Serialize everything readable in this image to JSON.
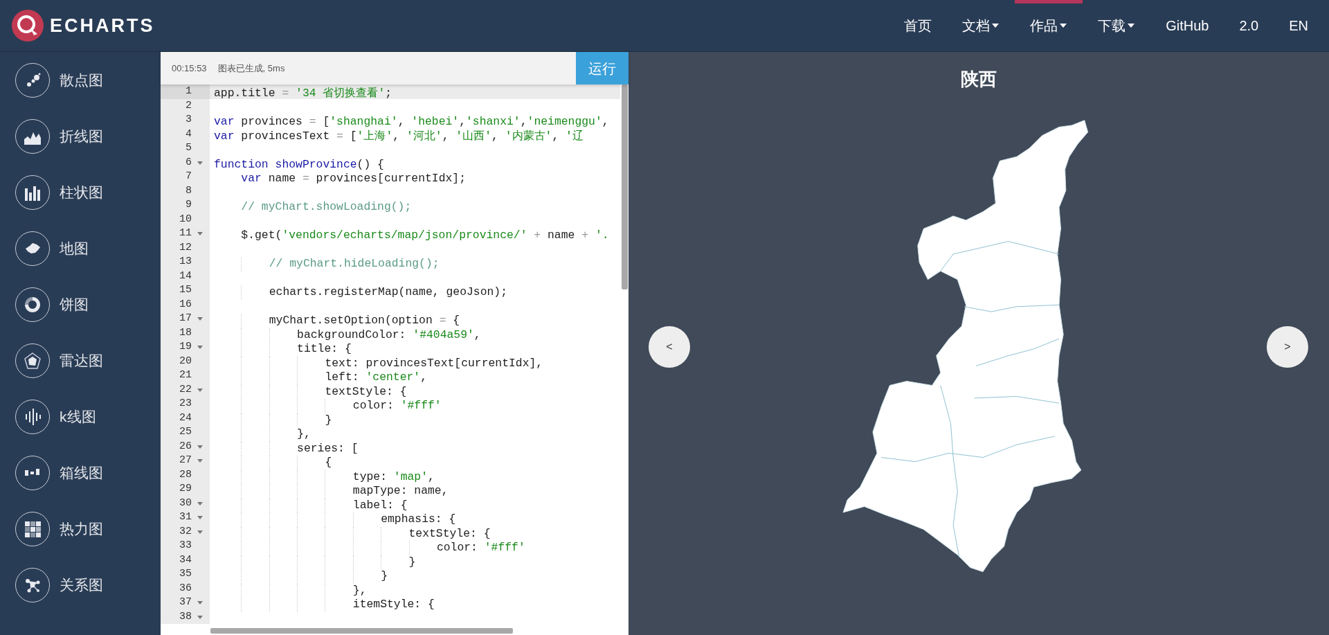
{
  "header": {
    "logo_text": "ECHARTS",
    "nav": [
      {
        "label": "首页",
        "dropdown": false,
        "selected": false
      },
      {
        "label": "文档",
        "dropdown": true,
        "selected": false
      },
      {
        "label": "作品",
        "dropdown": true,
        "selected": true
      },
      {
        "label": "下载",
        "dropdown": true,
        "selected": false
      },
      {
        "label": "GitHub",
        "dropdown": false,
        "selected": false
      },
      {
        "label": "2.0",
        "dropdown": false,
        "selected": false
      },
      {
        "label": "EN",
        "dropdown": false,
        "selected": false
      }
    ]
  },
  "sidebar": {
    "items": [
      {
        "label": "散点图",
        "kind": "scatter"
      },
      {
        "label": "折线图",
        "kind": "line"
      },
      {
        "label": "柱状图",
        "kind": "bar"
      },
      {
        "label": "地图",
        "kind": "map"
      },
      {
        "label": "饼图",
        "kind": "pie"
      },
      {
        "label": "雷达图",
        "kind": "radar"
      },
      {
        "label": "k线图",
        "kind": "candlestick"
      },
      {
        "label": "箱线图",
        "kind": "boxplot"
      },
      {
        "label": "热力图",
        "kind": "heatmap"
      },
      {
        "label": "关系图",
        "kind": "graph"
      }
    ]
  },
  "editor": {
    "time": "00:15:53",
    "status": "图表已生成, 5ms",
    "run_button": "运行",
    "lines": [
      {
        "n": "1",
        "active": true,
        "fold": false,
        "tokens": [
          {
            "kind": "plain",
            "t": "app.title "
          },
          {
            "kind": "op",
            "t": "= "
          },
          {
            "kind": "str",
            "t": "'34 省切换查看'"
          },
          {
            "kind": "plain",
            "t": ";"
          }
        ]
      },
      {
        "n": "2",
        "active": false,
        "fold": false
      },
      {
        "n": "3",
        "active": false,
        "fold": false,
        "tokens": [
          {
            "kind": "kw",
            "t": "var"
          },
          {
            "kind": "plain",
            "t": " provinces "
          },
          {
            "kind": "op",
            "t": "= "
          },
          {
            "kind": "plain",
            "t": "["
          },
          {
            "kind": "str",
            "t": "'shanghai'"
          },
          {
            "kind": "plain",
            "t": ", "
          },
          {
            "kind": "str",
            "t": "'hebei'"
          },
          {
            "kind": "plain",
            "t": ","
          },
          {
            "kind": "str",
            "t": "'shanxi'"
          },
          {
            "kind": "plain",
            "t": ","
          },
          {
            "kind": "str",
            "t": "'neimenggu'"
          },
          {
            "kind": "plain",
            "t": ","
          }
        ]
      },
      {
        "n": "4",
        "active": false,
        "fold": false,
        "tokens": [
          {
            "kind": "kw",
            "t": "var"
          },
          {
            "kind": "plain",
            "t": " provincesText "
          },
          {
            "kind": "op",
            "t": "= "
          },
          {
            "kind": "plain",
            "t": "["
          },
          {
            "kind": "str",
            "t": "'上海'"
          },
          {
            "kind": "plain",
            "t": ", "
          },
          {
            "kind": "str",
            "t": "'河北'"
          },
          {
            "kind": "plain",
            "t": ", "
          },
          {
            "kind": "str",
            "t": "'山西'"
          },
          {
            "kind": "plain",
            "t": ", "
          },
          {
            "kind": "str",
            "t": "'内蒙古'"
          },
          {
            "kind": "plain",
            "t": ", "
          },
          {
            "kind": "str",
            "t": "'辽"
          }
        ]
      },
      {
        "n": "5",
        "active": false,
        "fold": false
      },
      {
        "n": "6",
        "active": false,
        "fold": true,
        "tokens": [
          {
            "kind": "kw",
            "t": "function"
          },
          {
            "kind": "kw",
            "t": " showProvince"
          },
          {
            "kind": "plain",
            "t": "() {"
          }
        ]
      },
      {
        "n": "7",
        "active": false,
        "fold": false,
        "tokens": [
          {
            "kind": "kw",
            "t": "    var"
          },
          {
            "kind": "plain",
            "t": " name "
          },
          {
            "kind": "op",
            "t": "= "
          },
          {
            "kind": "plain",
            "t": "provinces[currentIdx];"
          }
        ]
      },
      {
        "n": "8",
        "active": false,
        "fold": false
      },
      {
        "n": "9",
        "active": false,
        "fold": false,
        "tokens": [
          {
            "kind": "com",
            "t": "    // myChart.showLoading();"
          }
        ]
      },
      {
        "n": "10",
        "active": false,
        "fold": false
      },
      {
        "n": "11",
        "active": false,
        "fold": true,
        "tokens": [
          {
            "kind": "plain",
            "t": "    $.get("
          },
          {
            "kind": "str",
            "t": "'vendors/echarts/map/json/province/'"
          },
          {
            "kind": "op",
            "t": " + "
          },
          {
            "kind": "plain",
            "t": "name "
          },
          {
            "kind": "op",
            "t": "+ "
          },
          {
            "kind": "str",
            "t": "'."
          }
        ]
      },
      {
        "n": "12",
        "active": false,
        "fold": false
      },
      {
        "n": "13",
        "active": false,
        "fold": false,
        "tokens": [
          {
            "kind": "com",
            "t": "        // myChart.hideLoading();"
          }
        ]
      },
      {
        "n": "14",
        "active": false,
        "fold": false
      },
      {
        "n": "15",
        "active": false,
        "fold": false,
        "tokens": [
          {
            "kind": "plain",
            "t": "        echarts.registerMap(name, geoJson);"
          }
        ]
      },
      {
        "n": "16",
        "active": false,
        "fold": false
      },
      {
        "n": "17",
        "active": false,
        "fold": true,
        "tokens": [
          {
            "kind": "plain",
            "t": "        myChart.setOption(option "
          },
          {
            "kind": "op",
            "t": "= "
          },
          {
            "kind": "plain",
            "t": "{"
          }
        ]
      },
      {
        "n": "18",
        "active": false,
        "fold": false,
        "tokens": [
          {
            "kind": "plain",
            "t": "            backgroundColor: "
          },
          {
            "kind": "str",
            "t": "'#404a59'"
          },
          {
            "kind": "plain",
            "t": ","
          }
        ]
      },
      {
        "n": "19",
        "active": false,
        "fold": true,
        "tokens": [
          {
            "kind": "plain",
            "t": "            title: {"
          }
        ]
      },
      {
        "n": "20",
        "active": false,
        "fold": false,
        "tokens": [
          {
            "kind": "plain",
            "t": "                text: provincesText[currentIdx],"
          }
        ]
      },
      {
        "n": "21",
        "active": false,
        "fold": false,
        "tokens": [
          {
            "kind": "plain",
            "t": "                left: "
          },
          {
            "kind": "str",
            "t": "'center'"
          },
          {
            "kind": "plain",
            "t": ","
          }
        ]
      },
      {
        "n": "22",
        "active": false,
        "fold": true,
        "tokens": [
          {
            "kind": "plain",
            "t": "                textStyle: {"
          }
        ]
      },
      {
        "n": "23",
        "active": false,
        "fold": false,
        "tokens": [
          {
            "kind": "plain",
            "t": "                    color: "
          },
          {
            "kind": "str",
            "t": "'#fff'"
          }
        ]
      },
      {
        "n": "24",
        "active": false,
        "fold": false,
        "tokens": [
          {
            "kind": "plain",
            "t": "                }"
          }
        ]
      },
      {
        "n": "25",
        "active": false,
        "fold": false,
        "tokens": [
          {
            "kind": "plain",
            "t": "            },"
          }
        ]
      },
      {
        "n": "26",
        "active": false,
        "fold": true,
        "tokens": [
          {
            "kind": "plain",
            "t": "            series: ["
          }
        ]
      },
      {
        "n": "27",
        "active": false,
        "fold": true,
        "tokens": [
          {
            "kind": "plain",
            "t": "                {"
          }
        ]
      },
      {
        "n": "28",
        "active": false,
        "fold": false,
        "tokens": [
          {
            "kind": "plain",
            "t": "                    type: "
          },
          {
            "kind": "str",
            "t": "'map'"
          },
          {
            "kind": "plain",
            "t": ","
          }
        ]
      },
      {
        "n": "29",
        "active": false,
        "fold": false,
        "tokens": [
          {
            "kind": "plain",
            "t": "                    mapType: name,"
          }
        ]
      },
      {
        "n": "30",
        "active": false,
        "fold": true,
        "tokens": [
          {
            "kind": "plain",
            "t": "                    label: {"
          }
        ]
      },
      {
        "n": "31",
        "active": false,
        "fold": true,
        "tokens": [
          {
            "kind": "plain",
            "t": "                        emphasis: {"
          }
        ]
      },
      {
        "n": "32",
        "active": false,
        "fold": true,
        "tokens": [
          {
            "kind": "plain",
            "t": "                            textStyle: {"
          }
        ]
      },
      {
        "n": "33",
        "active": false,
        "fold": false,
        "tokens": [
          {
            "kind": "plain",
            "t": "                                color: "
          },
          {
            "kind": "str",
            "t": "'#fff'"
          }
        ]
      },
      {
        "n": "34",
        "active": false,
        "fold": false,
        "tokens": [
          {
            "kind": "plain",
            "t": "                            }"
          }
        ]
      },
      {
        "n": "35",
        "active": false,
        "fold": false,
        "tokens": [
          {
            "kind": "plain",
            "t": "                        }"
          }
        ]
      },
      {
        "n": "36",
        "active": false,
        "fold": false,
        "tokens": [
          {
            "kind": "plain",
            "t": "                    },"
          }
        ]
      },
      {
        "n": "37",
        "active": false,
        "fold": true,
        "tokens": [
          {
            "kind": "plain",
            "t": "                    itemStyle: {"
          }
        ]
      },
      {
        "n": "38",
        "active": false,
        "fold": true
      }
    ]
  },
  "chart": {
    "title": "陕西",
    "prev_button": "<",
    "next_button": ">"
  }
}
